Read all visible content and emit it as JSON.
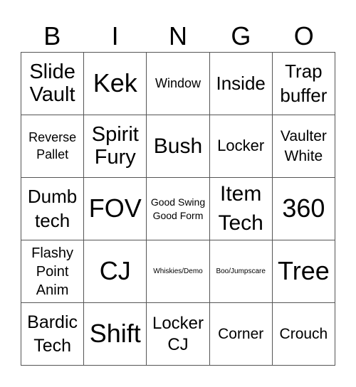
{
  "header": [
    "B",
    "I",
    "N",
    "G",
    "O"
  ],
  "cells": [
    [
      "Slide Vault",
      "Kek",
      "Window",
      "Inside",
      "Trap buffer"
    ],
    [
      "Reverse Pallet",
      "Spirit Fury",
      "Bush",
      "Locker",
      "Vaulter White"
    ],
    [
      "Dumb tech",
      "FOV",
      "Good Swing Good Form",
      "Item Tech",
      "360"
    ],
    [
      "Flashy Point Anim",
      "CJ",
      "Whiskies/Demo",
      "Boo/Jumpscare",
      "Tree"
    ],
    [
      "Bardic Tech",
      "Shift",
      "Locker CJ",
      "Corner",
      "Crouch"
    ]
  ]
}
